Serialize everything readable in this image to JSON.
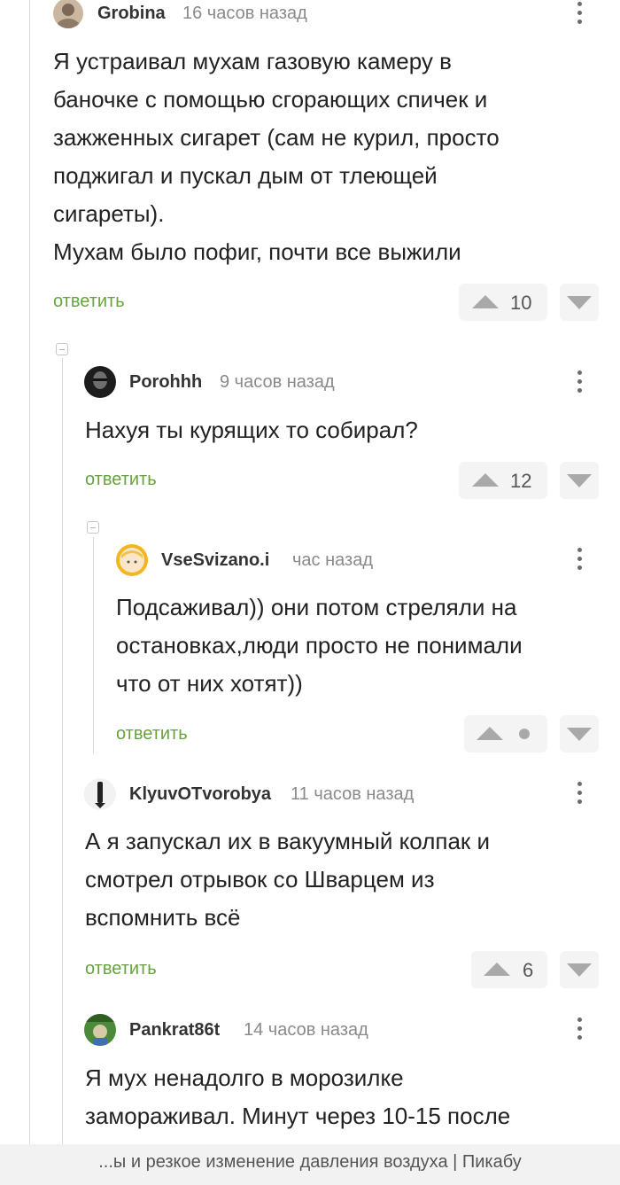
{
  "comments": [
    {
      "author": "Grobina",
      "time": "16 часов назад",
      "lines": [
        "Я устраивал мухам газовую камеру в",
        "баночке с помощью сгорающих спичек и",
        "зажженных сигарет (сам не курил, просто",
        "поджигал и пускал дым от тлеющей",
        "сигареты).",
        "Мухам было пофиг, почти все выжили"
      ],
      "reply_label": "ответить",
      "rating": "10"
    },
    {
      "author": "Porohhh",
      "time": "9 часов назад",
      "lines": [
        "Нахуя ты курящих то собирал?"
      ],
      "reply_label": "ответить",
      "rating": "12"
    },
    {
      "author": "VseSvizano.i",
      "time": "час назад",
      "lines": [
        "Подсаживал)) они потом стреляли на",
        "остановках,люди просто не понимали",
        "что от них хотят))"
      ],
      "reply_label": "ответить",
      "rating": ""
    },
    {
      "author": "KlyuvOTvorobya",
      "time": "11 часов назад",
      "lines": [
        "А я запускал их в вакуумный колпак и",
        "смотрел отрывок со Шварцем из",
        "вспомнить всё"
      ],
      "reply_label": "ответить",
      "rating": "6"
    },
    {
      "author": "Pankrat86t",
      "time": "14 часов назад",
      "lines": [
        "Я мух ненадолго в морозилке",
        "замораживал. Минут через 10-15 после"
      ]
    }
  ],
  "footer": {
    "text": "...ы и резкое изменение давления воздуха | Пикабу"
  },
  "colors": {
    "reply": "#67a23f",
    "vote_bg": "#f4f4f4",
    "arrow": "#a9a9a9",
    "thread_line": "#d9d9d9"
  }
}
